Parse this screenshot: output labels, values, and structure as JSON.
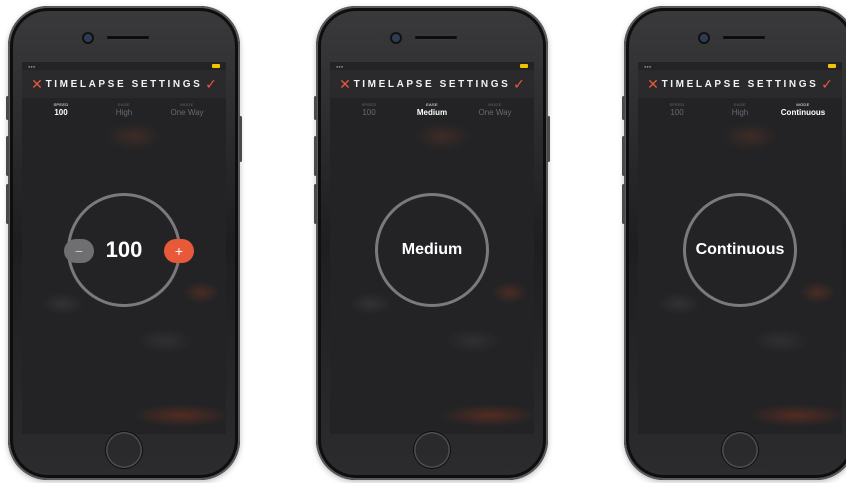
{
  "screens": [
    {
      "title": "TIMELAPSE SETTINGS",
      "close_icon": "✕",
      "confirm_icon": "✓",
      "tabs": [
        {
          "label": "SPEED",
          "value": "100"
        },
        {
          "label": "EASE",
          "value": "High"
        },
        {
          "label": "MODE",
          "value": "One Way"
        }
      ],
      "active_tab": "SPEED",
      "dial_value": "100",
      "minus_symbol": "−",
      "plus_symbol": "+"
    },
    {
      "title": "TIMELAPSE SETTINGS",
      "close_icon": "✕",
      "confirm_icon": "✓",
      "tabs": [
        {
          "label": "SPEED",
          "value": "100"
        },
        {
          "label": "EASE",
          "value": "Medium"
        },
        {
          "label": "MODE",
          "value": "One Way"
        }
      ],
      "active_tab": "EASE",
      "dial_value": "Medium"
    },
    {
      "title": "TIMELAPSE SETTINGS",
      "close_icon": "✕",
      "confirm_icon": "✓",
      "tabs": [
        {
          "label": "SPEED",
          "value": "100"
        },
        {
          "label": "EASE",
          "value": "High"
        },
        {
          "label": "MODE",
          "value": "Continuous"
        }
      ],
      "active_tab": "MODE",
      "dial_value": "Continuous"
    }
  ],
  "colors": {
    "accent": "#e8593a",
    "screen_bg": "#232325",
    "nav_bg": "#2a2a2c",
    "dial_ring": "#7a7a7c"
  }
}
